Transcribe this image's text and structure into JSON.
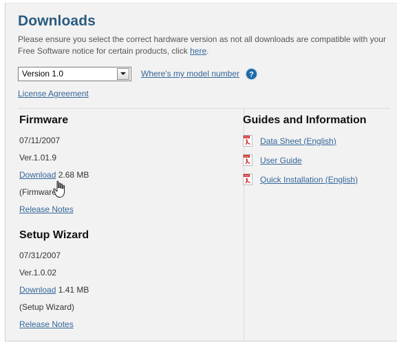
{
  "header": {
    "title": "Downloads",
    "intro_line1": "Please ensure you select the correct hardware version as not all downloads are compatible with your",
    "intro_line2_pre": "Free Software notice for certain products, click",
    "intro_here_link": "here",
    "intro_line2_post": "."
  },
  "version_select": {
    "value": "Version 1.0",
    "caret_icon": "chevron-down-icon"
  },
  "model_help": {
    "link_label": "Where's my model number",
    "icon": "question-mark-icon",
    "icon_color": "#1f6aa5"
  },
  "license_link": "License Agreement",
  "colors": {
    "title": "#2a5b80",
    "link": "#336699",
    "body_text": "#555555",
    "panel_bg": "#f2f2f2",
    "divider": "#dadada",
    "pdf_red": "#cc2222"
  },
  "left_column": {
    "sections": [
      {
        "heading": "Firmware",
        "date": "07/11/2007",
        "version": "Ver.1.01.9",
        "download_label": "Download",
        "size": "2.68 MB",
        "type": "(Firmware)",
        "release_notes_label": "Release Notes"
      },
      {
        "heading": "Setup Wizard",
        "date": "07/31/2007",
        "version": "Ver.1.0.02",
        "download_label": "Download",
        "size": "1.41 MB",
        "type": "(Setup Wizard)",
        "release_notes_label": "Release Notes"
      }
    ]
  },
  "right_column": {
    "heading": "Guides and Information",
    "items": [
      {
        "label": "Data Sheet (English)",
        "icon": "pdf-file-icon"
      },
      {
        "label": "User Guide",
        "icon": "pdf-file-icon"
      },
      {
        "label": "Quick Installation (English)",
        "icon": "pdf-file-icon"
      }
    ]
  },
  "cursor": {
    "icon": "pointing-hand-cursor"
  }
}
